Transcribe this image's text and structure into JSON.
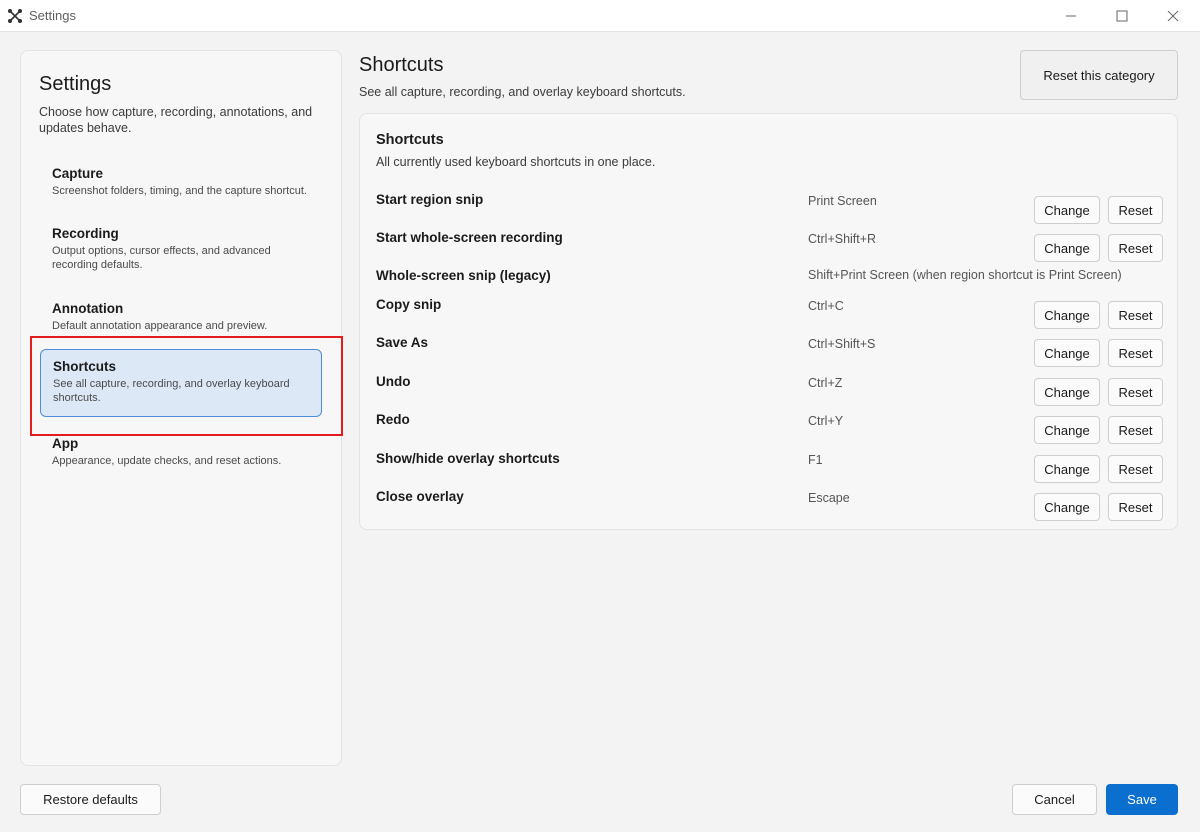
{
  "window": {
    "title": "Settings"
  },
  "sidebar": {
    "title": "Settings",
    "description": "Choose how capture, recording, annotations, and updates behave.",
    "items": [
      {
        "title": "Capture",
        "subtitle": "Screenshot folders, timing, and the capture shortcut."
      },
      {
        "title": "Recording",
        "subtitle": "Output options, cursor effects, and advanced recording defaults."
      },
      {
        "title": "Annotation",
        "subtitle": "Default annotation appearance and preview."
      },
      {
        "title": "Shortcuts",
        "subtitle": "See all capture, recording, and overlay keyboard shortcuts.",
        "selected": true
      },
      {
        "title": "App",
        "subtitle": "Appearance, update checks, and reset actions."
      }
    ]
  },
  "main": {
    "title": "Shortcuts",
    "description": "See all capture, recording, and overlay keyboard shortcuts.",
    "reset_category_label": "Reset this category",
    "panel": {
      "title": "Shortcuts",
      "description": "All currently used keyboard shortcuts in one place.",
      "change_label": "Change",
      "reset_label": "Reset",
      "rows": [
        {
          "label": "Start region snip",
          "key": "Print Screen"
        },
        {
          "label": "Start whole-screen recording",
          "key": "Ctrl+Shift+R"
        },
        {
          "label": "Whole-screen snip (legacy)",
          "key": "Shift+Print Screen (when region shortcut is Print Screen)"
        },
        {
          "label": "Copy snip",
          "key": "Ctrl+C"
        },
        {
          "label": "Save As",
          "key": "Ctrl+Shift+S"
        },
        {
          "label": "Undo",
          "key": "Ctrl+Z"
        },
        {
          "label": "Redo",
          "key": "Ctrl+Y"
        },
        {
          "label": "Show/hide overlay shortcuts",
          "key": "F1"
        },
        {
          "label": "Close overlay",
          "key": "Escape"
        }
      ]
    }
  },
  "footer": {
    "restore_label": "Restore defaults",
    "cancel_label": "Cancel",
    "save_label": "Save"
  },
  "colors": {
    "accent": "#0a6fcf",
    "selected_bg": "#dde8f7",
    "selected_border": "#4f8ed6",
    "highlight": "#e11d1d"
  },
  "icons": {
    "app": "snip-cross-icon",
    "minimize": "minimize-icon",
    "maximize": "maximize-icon",
    "close": "close-icon"
  }
}
